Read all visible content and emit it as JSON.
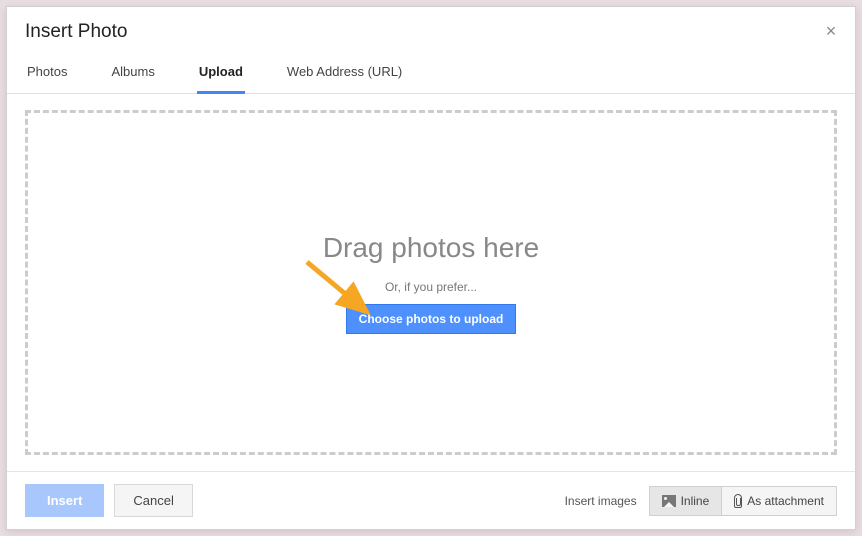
{
  "dialog": {
    "title": "Insert Photo",
    "tabs": [
      {
        "label": "Photos"
      },
      {
        "label": "Albums"
      },
      {
        "label": "Upload"
      },
      {
        "label": "Web Address (URL)"
      }
    ],
    "dropzone": {
      "main_text": "Drag photos here",
      "or_text": "Or, if you prefer...",
      "button_label": "Choose photos to upload"
    },
    "footer": {
      "insert_label": "Insert",
      "cancel_label": "Cancel",
      "insert_images_label": "Insert images",
      "inline_label": "Inline",
      "attachment_label": "As attachment"
    }
  }
}
